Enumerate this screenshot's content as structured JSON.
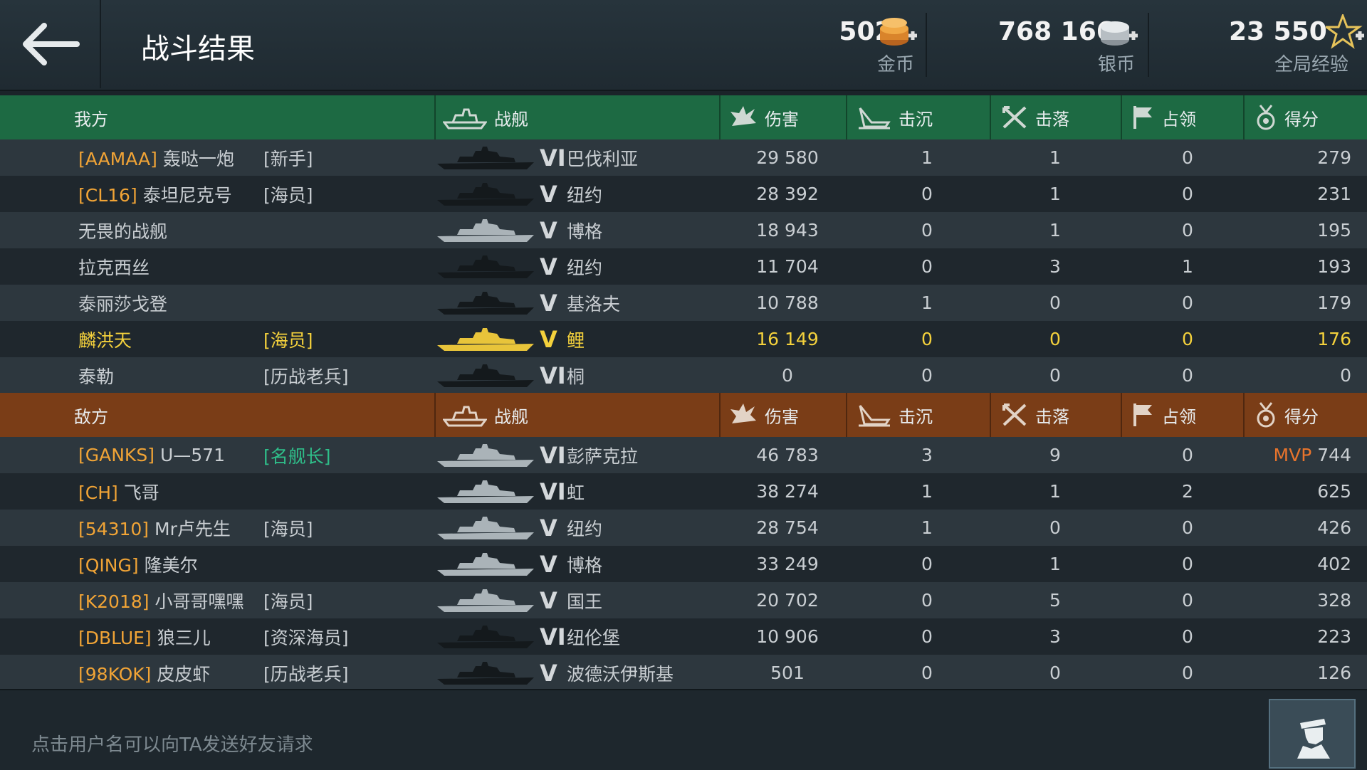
{
  "header": {
    "title": "战斗结果",
    "gold": {
      "value": "502",
      "label": "金币"
    },
    "silver": {
      "value": "768 166",
      "label": "银币"
    },
    "xp": {
      "value": "23 550",
      "label": "全局经验"
    }
  },
  "columns": {
    "ship": "战舰",
    "damage": "伤害",
    "sunk": "击沉",
    "downed": "击落",
    "capture": "占领",
    "score": "得分"
  },
  "ally": {
    "label": "我方",
    "rows": [
      {
        "clan": "[AAMAA]",
        "name": "轰哒一炮",
        "rank": "[新手]",
        "tier": "VI",
        "ship": "巴伐利亚",
        "damage": "29 580",
        "sunk": "1",
        "downed": "1",
        "capture": "0",
        "score": "279",
        "hull": "dark",
        "me": false,
        "mvp": ""
      },
      {
        "clan": "[CL16]",
        "name": "泰坦尼克号",
        "rank": "[海员]",
        "tier": "V",
        "ship": "纽约",
        "damage": "28 392",
        "sunk": "0",
        "downed": "1",
        "capture": "0",
        "score": "231",
        "hull": "dark",
        "me": false,
        "mvp": ""
      },
      {
        "clan": "",
        "name": "无畏的战舰",
        "rank": "",
        "tier": "V",
        "ship": "博格",
        "damage": "18 943",
        "sunk": "0",
        "downed": "1",
        "capture": "0",
        "score": "195",
        "hull": "light",
        "me": false,
        "mvp": ""
      },
      {
        "clan": "",
        "name": "拉克西丝",
        "rank": "",
        "tier": "V",
        "ship": "纽约",
        "damage": "11 704",
        "sunk": "0",
        "downed": "3",
        "capture": "1",
        "score": "193",
        "hull": "dark",
        "me": false,
        "mvp": ""
      },
      {
        "clan": "",
        "name": "泰丽莎戈登",
        "rank": "",
        "tier": "V",
        "ship": "基洛夫",
        "damage": "10 788",
        "sunk": "1",
        "downed": "0",
        "capture": "0",
        "score": "179",
        "hull": "dark",
        "me": false,
        "mvp": ""
      },
      {
        "clan": "",
        "name": "麟洪天",
        "rank": "[海员]",
        "tier": "V",
        "ship": "鲤",
        "damage": "16 149",
        "sunk": "0",
        "downed": "0",
        "capture": "0",
        "score": "176",
        "hull": "gold",
        "me": true,
        "mvp": ""
      },
      {
        "clan": "",
        "name": "泰勒",
        "rank": "[历战老兵]",
        "tier": "VI",
        "ship": "桐",
        "damage": "0",
        "sunk": "0",
        "downed": "0",
        "capture": "0",
        "score": "0",
        "hull": "dark",
        "me": false,
        "mvp": ""
      }
    ]
  },
  "enemy": {
    "label": "敌方",
    "rows": [
      {
        "clan": "[GANKS]",
        "name": "U—571",
        "rank": "[名舰长]",
        "tier": "VI",
        "ship": "彭萨克拉",
        "damage": "46 783",
        "sunk": "3",
        "downed": "9",
        "capture": "0",
        "score": "744",
        "hull": "light",
        "me": false,
        "mvp": "MVP"
      },
      {
        "clan": "[CH]",
        "name": "飞哥",
        "rank": "",
        "tier": "VI",
        "ship": "虹",
        "damage": "38 274",
        "sunk": "1",
        "downed": "1",
        "capture": "2",
        "score": "625",
        "hull": "light",
        "me": false,
        "mvp": ""
      },
      {
        "clan": "[54310]",
        "name": "Mr卢先生",
        "rank": "[海员]",
        "tier": "V",
        "ship": "纽约",
        "damage": "28 754",
        "sunk": "1",
        "downed": "0",
        "capture": "0",
        "score": "426",
        "hull": "light",
        "me": false,
        "mvp": ""
      },
      {
        "clan": "[QING]",
        "name": "隆美尔",
        "rank": "",
        "tier": "V",
        "ship": "博格",
        "damage": "33 249",
        "sunk": "0",
        "downed": "1",
        "capture": "0",
        "score": "402",
        "hull": "light",
        "me": false,
        "mvp": ""
      },
      {
        "clan": "[K2018]",
        "name": "小哥哥嘿嘿",
        "rank": "[海员]",
        "tier": "V",
        "ship": "国王",
        "damage": "20 702",
        "sunk": "0",
        "downed": "5",
        "capture": "0",
        "score": "328",
        "hull": "light",
        "me": false,
        "mvp": ""
      },
      {
        "clan": "[DBLUE]",
        "name": "狼三儿",
        "rank": "[资深海员]",
        "tier": "VI",
        "ship": "纽伦堡",
        "damage": "10 906",
        "sunk": "0",
        "downed": "3",
        "capture": "0",
        "score": "223",
        "hull": "dark",
        "me": false,
        "mvp": ""
      },
      {
        "clan": "[98KOK]",
        "name": "皮皮虾",
        "rank": "[历战老兵]",
        "tier": "V",
        "ship": "波德沃伊斯基",
        "damage": "501",
        "sunk": "0",
        "downed": "0",
        "capture": "0",
        "score": "126",
        "hull": "dark",
        "me": false,
        "mvp": ""
      }
    ]
  },
  "footer": {
    "hint": "点击用户名可以向TA发送好友请求"
  },
  "colors": {
    "ally_header": "#1d6a43",
    "enemy_header": "#7a3d17",
    "clan": "#f1a436",
    "me": "#f4d13c",
    "mvp": "#e8742c"
  },
  "icons": {
    "back": "back-arrow-icon",
    "gold": "gold-coins-icon",
    "silver": "silver-coins-icon",
    "xp": "star-icon",
    "ship": "warship-icon",
    "damage": "explosion-icon",
    "sunk": "sinking-ship-icon",
    "downed": "crossed-planes-icon",
    "capture": "flag-icon",
    "score": "medal-icon",
    "captain": "captain-portrait-icon"
  }
}
